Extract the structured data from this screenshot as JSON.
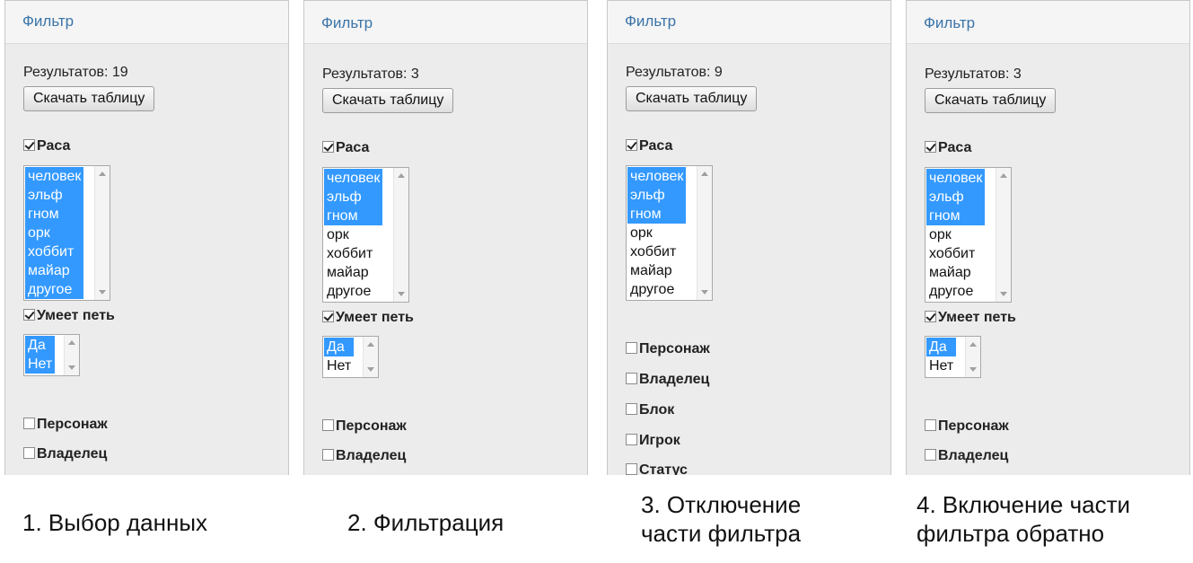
{
  "panels": [
    {
      "header": "Фильтр",
      "results": "Результатов: 19",
      "download": "Скачать таблицу",
      "race_label": "Раса",
      "race_options": [
        "человек",
        "эльф",
        "гном",
        "орк",
        "хоббит",
        "майар",
        "другое"
      ],
      "sing_label": "Умеет петь",
      "sing_options": [
        "Да",
        "Нет"
      ],
      "other_filters": [
        "Персонаж",
        "Владелец"
      ]
    },
    {
      "header": "Фильтр",
      "results": "Результатов: 3",
      "download": "Скачать таблицу",
      "race_label": "Раса",
      "race_options": [
        "человек",
        "эльф",
        "гном",
        "орк",
        "хоббит",
        "майар",
        "другое"
      ],
      "sing_label": "Умеет петь",
      "sing_options": [
        "Да",
        "Нет"
      ],
      "other_filters": [
        "Персонаж",
        "Владелец"
      ]
    },
    {
      "header": "Фильтр",
      "results": "Результатов: 9",
      "download": "Скачать таблицу",
      "race_label": "Раса",
      "race_options": [
        "человек",
        "эльф",
        "гном",
        "орк",
        "хоббит",
        "майар",
        "другое"
      ],
      "other_filters": [
        "Персонаж",
        "Владелец",
        "Блок",
        "Игрок",
        "Статус"
      ]
    },
    {
      "header": "Фильтр",
      "results": "Результатов: 3",
      "download": "Скачать таблицу",
      "race_label": "Раса",
      "race_options": [
        "человек",
        "эльф",
        "гном",
        "орк",
        "хоббит",
        "майар",
        "другое"
      ],
      "sing_label": "Умеет петь",
      "sing_options": [
        "Да",
        "Нет"
      ],
      "other_filters": [
        "Персонаж",
        "Владелец"
      ]
    }
  ],
  "captions": [
    "1. Выбор данных",
    "2. Фильтрация",
    "3. Отключение\nчасти фильтра",
    "4. Включение части\nфильтра обратно"
  ]
}
